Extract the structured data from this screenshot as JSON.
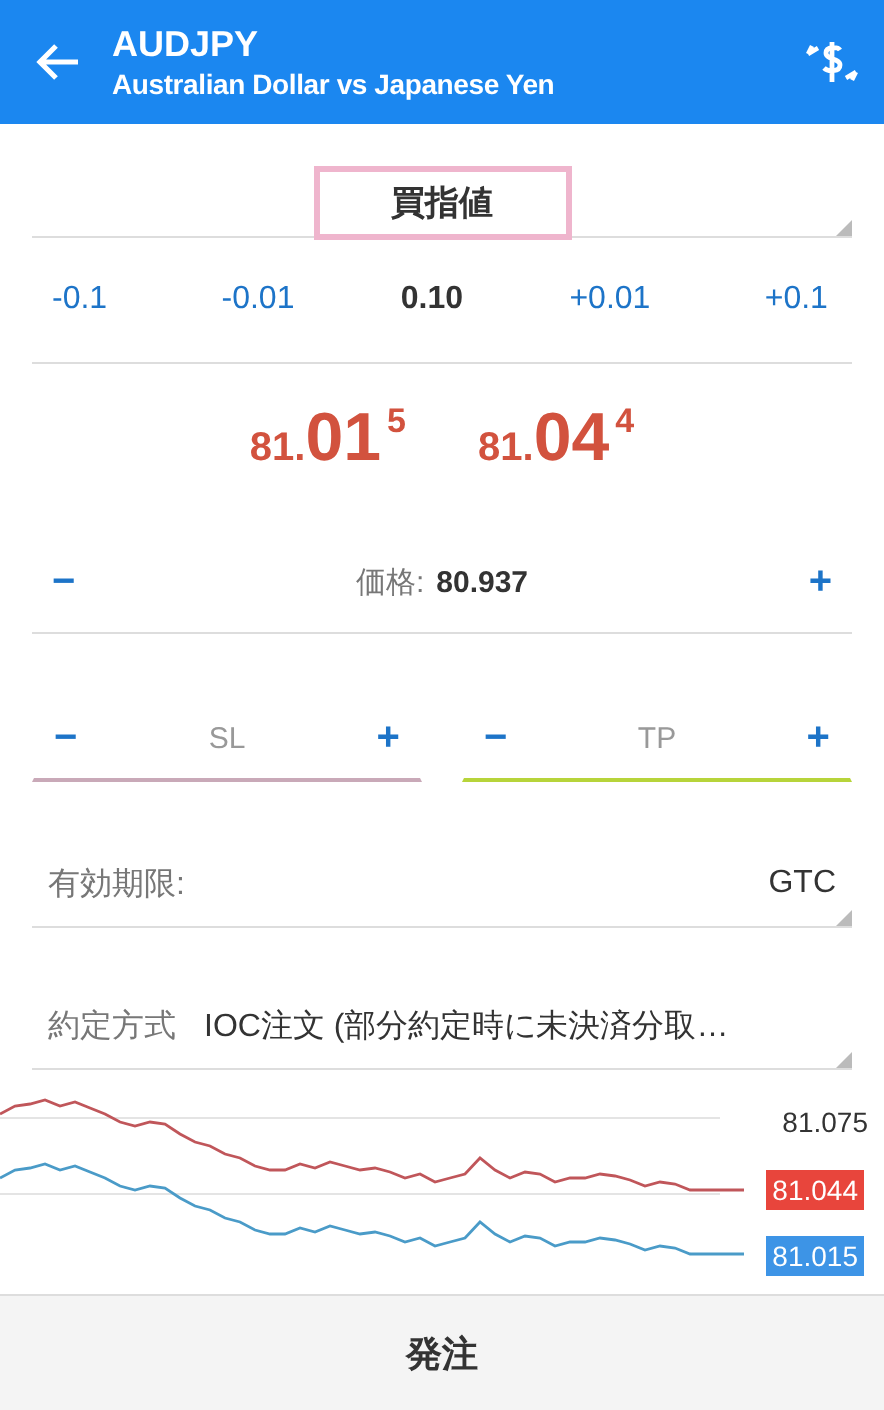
{
  "header": {
    "symbol": "AUDJPY",
    "description": "Australian Dollar vs Japanese Yen"
  },
  "order_type": {
    "value": "買指値",
    "highlighted": true
  },
  "volume": {
    "steps_minus": [
      "-0.1",
      "-0.01"
    ],
    "value": "0.10",
    "steps_plus": [
      "+0.01",
      "+0.1"
    ]
  },
  "quotes": [
    {
      "price": "81.**01**$^{5}$"
    },
    {
      "price": "81.**04**$^{4}$"
    }
  ],
  "price": {
    "decrement": "−",
    "label": "価格:",
    "value": "80.937",
    "increment": "+"
  },
  "levels": [
    {
      "decrement": "−",
      "label": "SL",
      "increment": "+",
      "color": "#c9a9b8"
    },
    {
      "decrement": "−",
      "label": "TP",
      "increment": "+",
      "color": "#b7d43a"
    }
  ],
  "expiration": {
    "label": "有効期限:",
    "value": "GTC"
  },
  "filling": {
    "label": "約定方式",
    "value": "IOC注文 (部分約定時に未決済分取…"
  },
  "chart": {
    "grid_label": "81.075",
    "tags": [
      {
        "text": "81.044",
        "color": "#e8453c"
      },
      {
        "text": "81.015",
        "color": "#3d94e6"
      }
    ]
  },
  "submit": {
    "label": "発注"
  }
}
